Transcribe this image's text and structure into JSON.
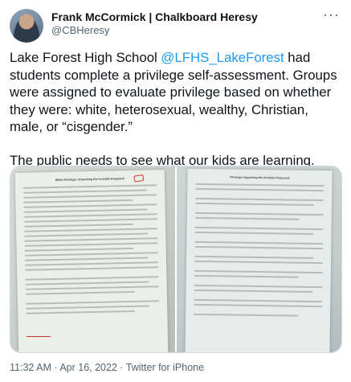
{
  "author": {
    "name": "Frank McCormick | Chalkboard Heresy",
    "handle": "@CBHeresy"
  },
  "tweet": {
    "text_pre": "Lake Forest High School ",
    "mention": "@LFHS_LakeForest",
    "text_post": " had students complete a privilege self-assessment. Groups were assigned to evaluate privilege based on whether they were: white, heterosexual, wealthy, Christian, male, or “cisgender.”",
    "paragraph2": "The public needs to see what our kids are learning."
  },
  "media": {
    "count": 2,
    "left_sheet_title": "White Privilege: Unpacking the Invisible Knapsack",
    "right_sheet_title": "Privilege Unpacking the Invisible Knapsack"
  },
  "meta": {
    "time": "11:32 AM",
    "separator": " · ",
    "date": "Apr 16, 2022",
    "source": "Twitter for iPhone"
  },
  "icons": {
    "more": "more-options-icon"
  }
}
